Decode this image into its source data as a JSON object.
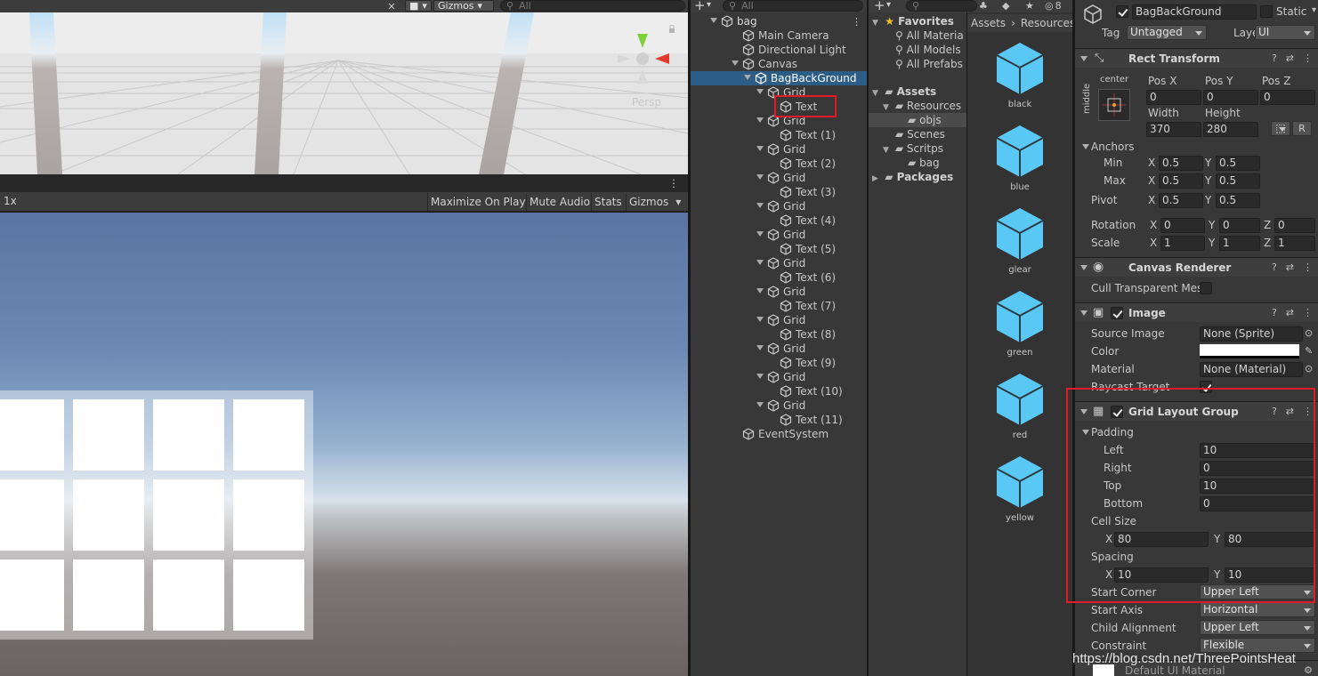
{
  "scene": {
    "gizmos_label": "Gizmos",
    "search_placeholder": "All",
    "persp_label": "Persp"
  },
  "game": {
    "scale_label": "1x",
    "maximize_label": "Maximize On Play",
    "mute_label": "Mute Audio",
    "stats_label": "Stats",
    "gizmos_label": "Gizmos"
  },
  "hierarchy": {
    "search_placeholder": "All",
    "items": [
      {
        "label": "bag"
      },
      {
        "label": "Main Camera"
      },
      {
        "label": "Directional Light"
      },
      {
        "label": "Canvas"
      },
      {
        "label": "BagBackGround"
      },
      {
        "label": "Grid"
      },
      {
        "label": "Text"
      },
      {
        "label": "Grid"
      },
      {
        "label": "Text (1)"
      },
      {
        "label": "Grid"
      },
      {
        "label": "Text (2)"
      },
      {
        "label": "Grid"
      },
      {
        "label": "Text (3)"
      },
      {
        "label": "Grid"
      },
      {
        "label": "Text (4)"
      },
      {
        "label": "Grid"
      },
      {
        "label": "Text (5)"
      },
      {
        "label": "Grid"
      },
      {
        "label": "Text (6)"
      },
      {
        "label": "Grid"
      },
      {
        "label": "Text (7)"
      },
      {
        "label": "Grid"
      },
      {
        "label": "Text (8)"
      },
      {
        "label": "Grid"
      },
      {
        "label": "Text (9)"
      },
      {
        "label": "Grid"
      },
      {
        "label": "Text (10)"
      },
      {
        "label": "Grid"
      },
      {
        "label": "Text (11)"
      },
      {
        "label": "EventSystem"
      }
    ]
  },
  "project": {
    "search_placeholder": "",
    "hidden_count": "8",
    "favorites": {
      "title": "Favorites",
      "items": [
        "All Materia",
        "All Models",
        "All Prefabs"
      ]
    },
    "assets": {
      "title": "Assets",
      "items": [
        "Resources",
        "objs",
        "Scenes",
        "Scritps",
        "bag"
      ],
      "packages": "Packages"
    },
    "breadcrumb": [
      "Assets",
      "Resources"
    ],
    "asset_items": [
      "black",
      "blue",
      "glear",
      "green",
      "red",
      "yellow"
    ]
  },
  "inspector": {
    "object_name": "BagBackGround",
    "static_label": "Static",
    "tag_label": "Tag",
    "tag_value": "Untagged",
    "layer_label": "Layer",
    "layer_value": "UI",
    "rect_transform": {
      "title": "Rect Transform",
      "anchor_h": "center",
      "anchor_v": "middle",
      "pos_x_label": "Pos X",
      "pos_y_label": "Pos Y",
      "pos_z_label": "Pos Z",
      "pos_x": "0",
      "pos_y": "0",
      "pos_z": "0",
      "width_label": "Width",
      "height_label": "Height",
      "width": "370",
      "height": "280",
      "r_button": "R",
      "anchors_label": "Anchors",
      "min_label": "Min",
      "max_label": "Max",
      "min_x": "0.5",
      "min_y": "0.5",
      "max_x": "0.5",
      "max_y": "0.5",
      "pivot_label": "Pivot",
      "pivot_x": "0.5",
      "pivot_y": "0.5",
      "rotation_label": "Rotation",
      "rot_x": "0",
      "rot_y": "0",
      "rot_z": "0",
      "scale_label": "Scale",
      "scale_x": "1",
      "scale_y": "1",
      "scale_z": "1",
      "x": "X",
      "y": "Y",
      "z": "Z"
    },
    "canvas_renderer": {
      "title": "Canvas Renderer",
      "cull_label": "Cull Transparent Mes"
    },
    "image": {
      "title": "Image",
      "source_label": "Source Image",
      "source_value": "None (Sprite)",
      "color_label": "Color",
      "material_label": "Material",
      "material_value": "None (Material)",
      "raycast_label": "Raycast Target"
    },
    "grid_layout": {
      "title": "Grid Layout Group",
      "padding_label": "Padding",
      "left_label": "Left",
      "left": "10",
      "right_label": "Right",
      "right": "0",
      "top_label": "Top",
      "top": "10",
      "bottom_label": "Bottom",
      "bottom": "0",
      "cell_size_label": "Cell Size",
      "cell_x": "80",
      "cell_y": "80",
      "spacing_label": "Spacing",
      "spacing_x": "10",
      "spacing_y": "10",
      "start_corner_label": "Start Corner",
      "start_corner": "Upper Left",
      "start_axis_label": "Start Axis",
      "start_axis": "Horizontal",
      "child_align_label": "Child Alignment",
      "child_align": "Upper Left",
      "constraint_label": "Constraint",
      "constraint": "Flexible",
      "default_material": "Default UI Material"
    }
  },
  "watermark": "https://blog.csdn.net/ThreePointsHeat",
  "colors": {
    "selection": "#2c5d87",
    "highlight": "#e01b24",
    "asset_cube": "#5ac8f5"
  }
}
